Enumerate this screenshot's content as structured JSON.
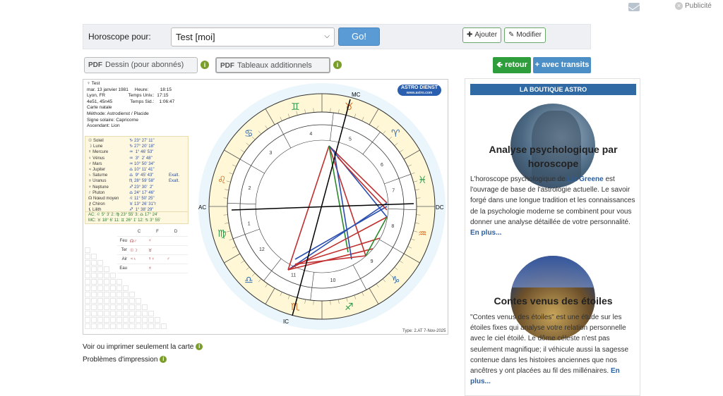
{
  "topbar": {
    "mail_icon": "envelope-icon",
    "pub_label": "Publicité",
    "pub_close": "×"
  },
  "toolbar": {
    "label": "Horoscope pour:",
    "select_value": "Test [moi]",
    "go_label": "Go!",
    "add_label": "Ajouter",
    "edit_label": "Modifier"
  },
  "pdf": {
    "prefix": "PDF",
    "drawing_label": "Dessin (pour abonnés)",
    "tables_label": "Tableaux additionnels",
    "info": "i"
  },
  "nav": {
    "back_label": "retour",
    "transits_label": "avec transits",
    "back_arrow": "🡸",
    "plus": "+"
  },
  "chart": {
    "header_lines": [
      "♀ Test",
      "mar. 13 janvier 1981     Heure:         18:15",
      "Lyon, FR                  Temps Univ.:  17:15",
      "4e51, 45n45              Temps Sid.:    1:06:47",
      "Carte natale",
      "Méthode: Astrodienst / Placide",
      "Signe solaire: Capricorne",
      "Ascendant: Lion"
    ],
    "logo_name": "ASTRO DIENST",
    "logo_site": "www.astro.com",
    "planets": [
      {
        "name": "☉ Soleil",
        "pos": "♑ 23° 27' 11\"",
        "extra": ""
      },
      {
        "name": "☽ Lune",
        "pos": "♑ 27° 20' 18\"",
        "extra": ""
      },
      {
        "name": "☿ Mercure",
        "pos": "♒  1° 46' 53\"",
        "extra": ""
      },
      {
        "name": "♀ Vénus",
        "pos": "♒  3°  2' 48\"",
        "extra": ""
      },
      {
        "name": "♂ Mars",
        "pos": "♒ 10° 50' 34\"",
        "extra": ""
      },
      {
        "name": "♃ Jupiter",
        "pos": "♎ 10° 11' 41\"",
        "extra": ""
      },
      {
        "name": "♄ Saturne",
        "pos": "♎  9° 45' 43\"",
        "extra": "Exalt."
      },
      {
        "name": "♅ Uranus",
        "pos": "♏ 28° 59' 58\"",
        "extra": "Exalt."
      },
      {
        "name": "♆ Neptune",
        "pos": "♐ 23° 30'  2\"",
        "extra": ""
      },
      {
        "name": "♇ Pluton",
        "pos": "♎ 24° 17' 46\"",
        "extra": ""
      },
      {
        "name": "☊ Nœud moyen",
        "pos": "♌ 11° 50' 25\"",
        "extra": ""
      },
      {
        "name": "⚷ Chiron",
        "pos": "♉ 13° 26' 31\"r",
        "extra": ""
      },
      {
        "name": "⚸ Lilith",
        "pos": "♐  1° 38' 29\"",
        "extra": ""
      }
    ],
    "houses_line1": "AC: ♌ 5° 3'    2: ♍ 23° 55'    3: ♎ 17° 24'",
    "houses_line2": "MC: ♉ 18° 6'  11: ♊ 26° 1'    12: ♋ 3° 55'",
    "elements_header": [
      "C",
      "F",
      "D"
    ],
    "elements": [
      {
        "label": "Feu",
        "c": "☊♂",
        "f": "♆",
        "d": ""
      },
      {
        "label": "Ter",
        "c": "☉☽",
        "f": "♉",
        "d": ""
      },
      {
        "label": "Air",
        "c": "♃♄",
        "f": "☿♀",
        "d": "♂"
      },
      {
        "label": "Eau",
        "c": "",
        "f": "♅",
        "d": ""
      }
    ],
    "footer": "Type: 2.AT    7-Nov-2025",
    "axis_labels": {
      "ac": "AC",
      "dc": "DC",
      "mc": "MC",
      "ic": "IC"
    },
    "house_numbers": [
      "1",
      "2",
      "3",
      "4",
      "5",
      "6",
      "7",
      "8",
      "9",
      "10",
      "11",
      "12"
    ],
    "signs": [
      "♌",
      "♋",
      "♊",
      "♉",
      "♈",
      "♓",
      "♒",
      "♑",
      "♐",
      "♏",
      "♎",
      "♍"
    ]
  },
  "below": {
    "print_label": "Voir ou imprimer seulement la carte",
    "problems_label": "Problèmes d'impression",
    "info": "i"
  },
  "sidebar": {
    "header": "LA BOUTIQUE ASTRO",
    "item1_title": "Analyse psychologique par horoscope",
    "item1_text_a": "L'horoscope psychologique de ",
    "item1_author": "Liz Greene",
    "item1_text_b": " est l'ouvrage de base de l'astrologie actuelle. Le savoir forgé dans une longue tradition et les connaissances de la psychologie moderne se combinent pour vous donner une analyse détaillée de votre personnalité. ",
    "item1_more": "En plus...",
    "item2_title": "Contes venus des étoiles",
    "item2_text": "\"Contes venus des étoiles\" est une étude sur les étoiles fixes qui analyse votre relation personnelle avec le ciel étoilé. Le dôme céleste n'est pas seulement magnifique; il véhicule aussi la sagesse contenue dans les histoires anciennes que nos ancêtres y ont placées au fil des millénaires. ",
    "item2_more": "En plus..."
  }
}
